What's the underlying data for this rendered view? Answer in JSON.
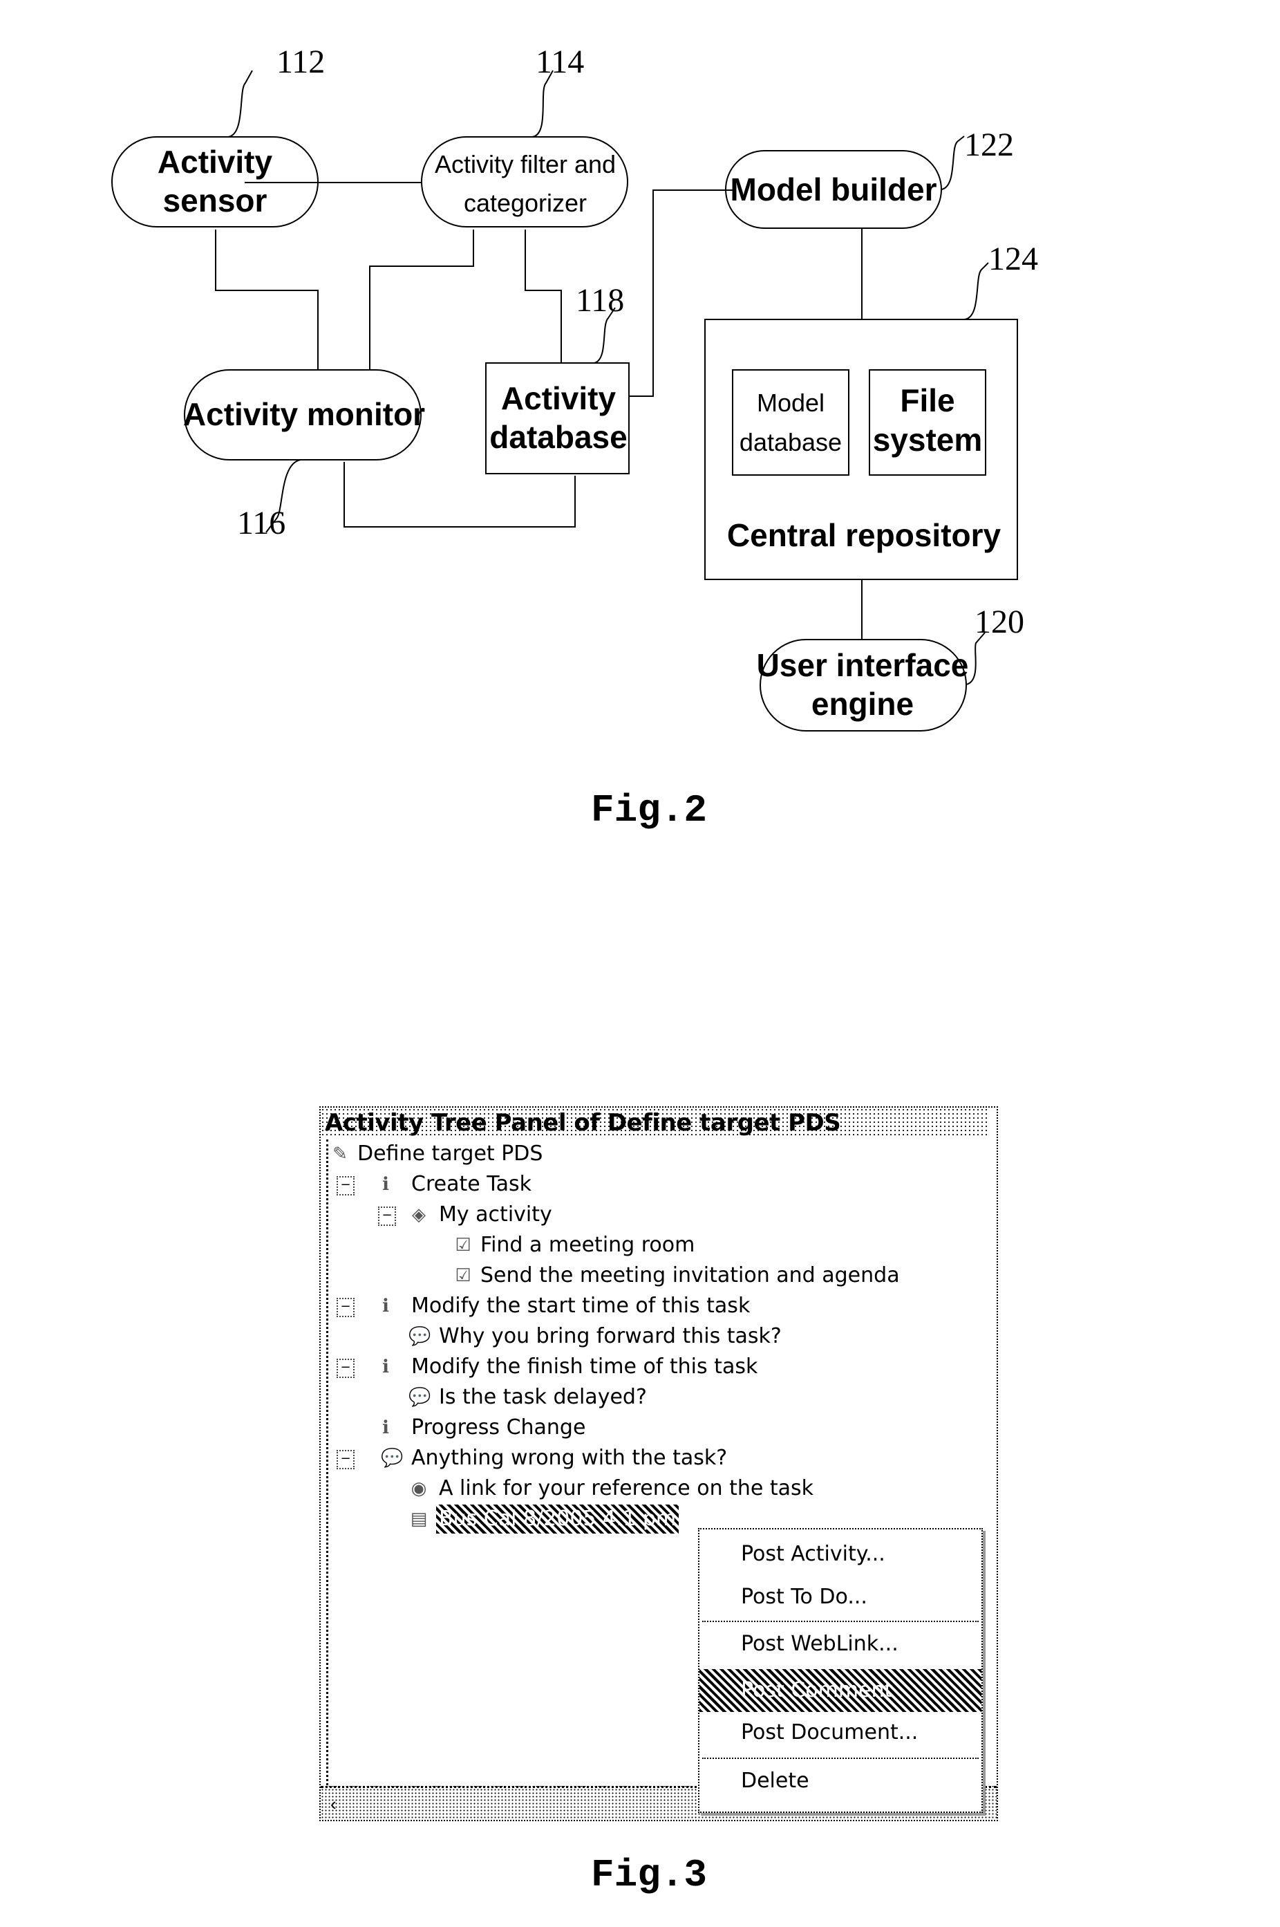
{
  "figure2": {
    "caption": "Fig.2",
    "nodes": {
      "activity_sensor": {
        "line1": "Activity",
        "line2": "sensor",
        "ref": "112"
      },
      "activity_filter": {
        "line1": "Activity filter and",
        "line2": "categorizer",
        "ref": "114"
      },
      "activity_monitor": {
        "line1": "Activity monitor",
        "ref": "116"
      },
      "activity_database": {
        "line1": "Activity",
        "line2": "database",
        "ref": "118"
      },
      "model_builder": {
        "line1": "Model builder",
        "ref": "122"
      },
      "central_repository": {
        "label": "Central repository",
        "ref": "124"
      },
      "model_database": {
        "line1": "Model",
        "line2": "database"
      },
      "file_system": {
        "line1": "File",
        "line2": "system"
      },
      "ui_engine": {
        "line1": "User interface",
        "line2": "engine",
        "ref": "120"
      }
    }
  },
  "figure3": {
    "caption": "Fig.3",
    "panel_title": "Activity Tree Panel of Define target PDS",
    "tree": [
      {
        "label": "Define target PDS",
        "icon": "project-icon"
      },
      {
        "label": "Create Task",
        "icon": "info-icon"
      },
      {
        "label": "My activity",
        "icon": "activity-icon"
      },
      {
        "label": "Find a meeting room",
        "icon": "checkbox-icon"
      },
      {
        "label": "Send the meeting invitation and agenda",
        "icon": "checkbox-icon"
      },
      {
        "label": "Modify the start time of this task",
        "icon": "info-icon"
      },
      {
        "label": "Why you bring forward this task?",
        "icon": "comment-icon"
      },
      {
        "label": "Modify the finish time of this task",
        "icon": "info-icon"
      },
      {
        "label": "Is the task delayed?",
        "icon": "comment-icon"
      },
      {
        "label": "Progress Change",
        "icon": "info-icon"
      },
      {
        "label": "Anything wrong with the task?",
        "icon": "comment-icon"
      },
      {
        "label": "A link for your reference on the task",
        "icon": "weblink-icon"
      },
      {
        "label": "Bus Cal 8/2005 4:1 pm",
        "icon": "document-icon"
      }
    ],
    "context_menu": [
      "Post Activity...",
      "Post To Do...",
      "Post WebLink...",
      "Post Comment",
      "Post Document...",
      "Delete"
    ]
  }
}
